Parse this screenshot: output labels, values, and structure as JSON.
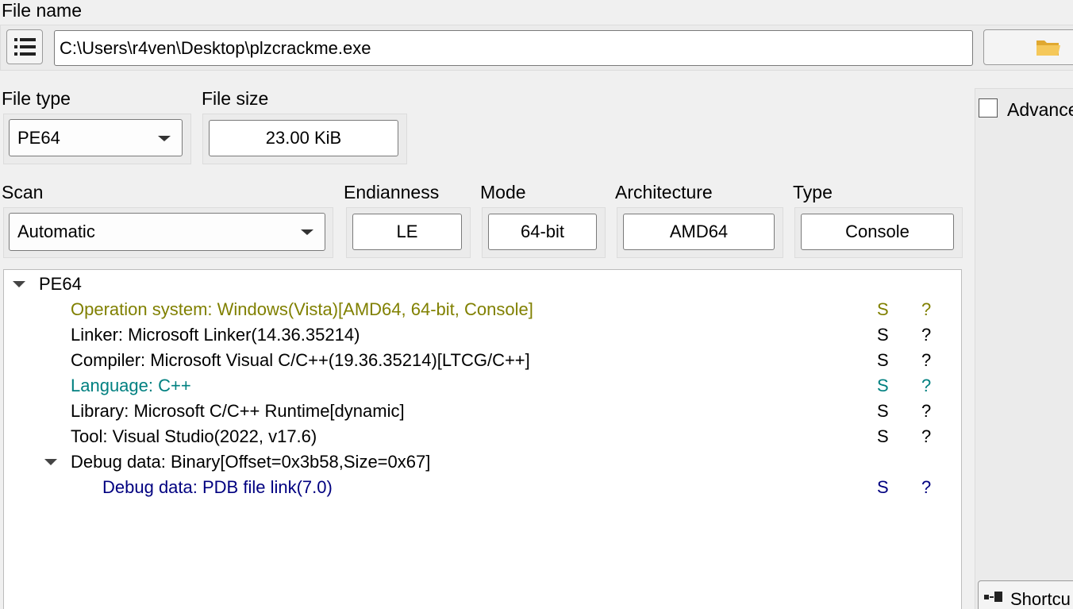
{
  "file": {
    "label": "File name",
    "path": "C:\\Users\\r4ven\\Desktop\\plzcrackme.exe"
  },
  "file_type": {
    "label": "File type",
    "value": "PE64"
  },
  "file_size": {
    "label": "File size",
    "value": "23.00 KiB"
  },
  "scan": {
    "label": "Scan",
    "value": "Automatic"
  },
  "info": {
    "endianness": {
      "label": "Endianness",
      "value": "LE"
    },
    "mode": {
      "label": "Mode",
      "value": "64-bit"
    },
    "architecture": {
      "label": "Architecture",
      "value": "AMD64"
    },
    "type": {
      "label": "Type",
      "value": "Console"
    }
  },
  "tree": {
    "root": "PE64",
    "rows": [
      {
        "text": "Operation system: Windows(Vista)[AMD64, 64-bit, Console]",
        "s": "S",
        "q": "?",
        "color": "#808000"
      },
      {
        "text": "Linker: Microsoft Linker(14.36.35214)",
        "s": "S",
        "q": "?",
        "color": "#000000"
      },
      {
        "text": "Compiler: Microsoft Visual C/C++(19.36.35214)[LTCG/C++]",
        "s": "S",
        "q": "?",
        "color": "#000000"
      },
      {
        "text": "Language: C++",
        "s": "S",
        "q": "?",
        "color": "#008080"
      },
      {
        "text": "Library: Microsoft C/C++ Runtime[dynamic]",
        "s": "S",
        "q": "?",
        "color": "#000000"
      },
      {
        "text": "Tool: Visual Studio(2022, v17.6)",
        "s": "S",
        "q": "?",
        "color": "#000000"
      }
    ],
    "debug_group": "Debug data: Binary[Offset=0x3b58,Size=0x67]",
    "debug_child": {
      "text": "Debug data: PDB file link(7.0)",
      "s": "S",
      "q": "?",
      "color": "#000080"
    }
  },
  "side": {
    "advanced_label": "Advance",
    "shortcuts_label": "Shortcu"
  },
  "icons": {
    "menu": "list-menu-icon",
    "folder": "folder-open-icon",
    "shortcuts": "shortcuts-icon"
  }
}
